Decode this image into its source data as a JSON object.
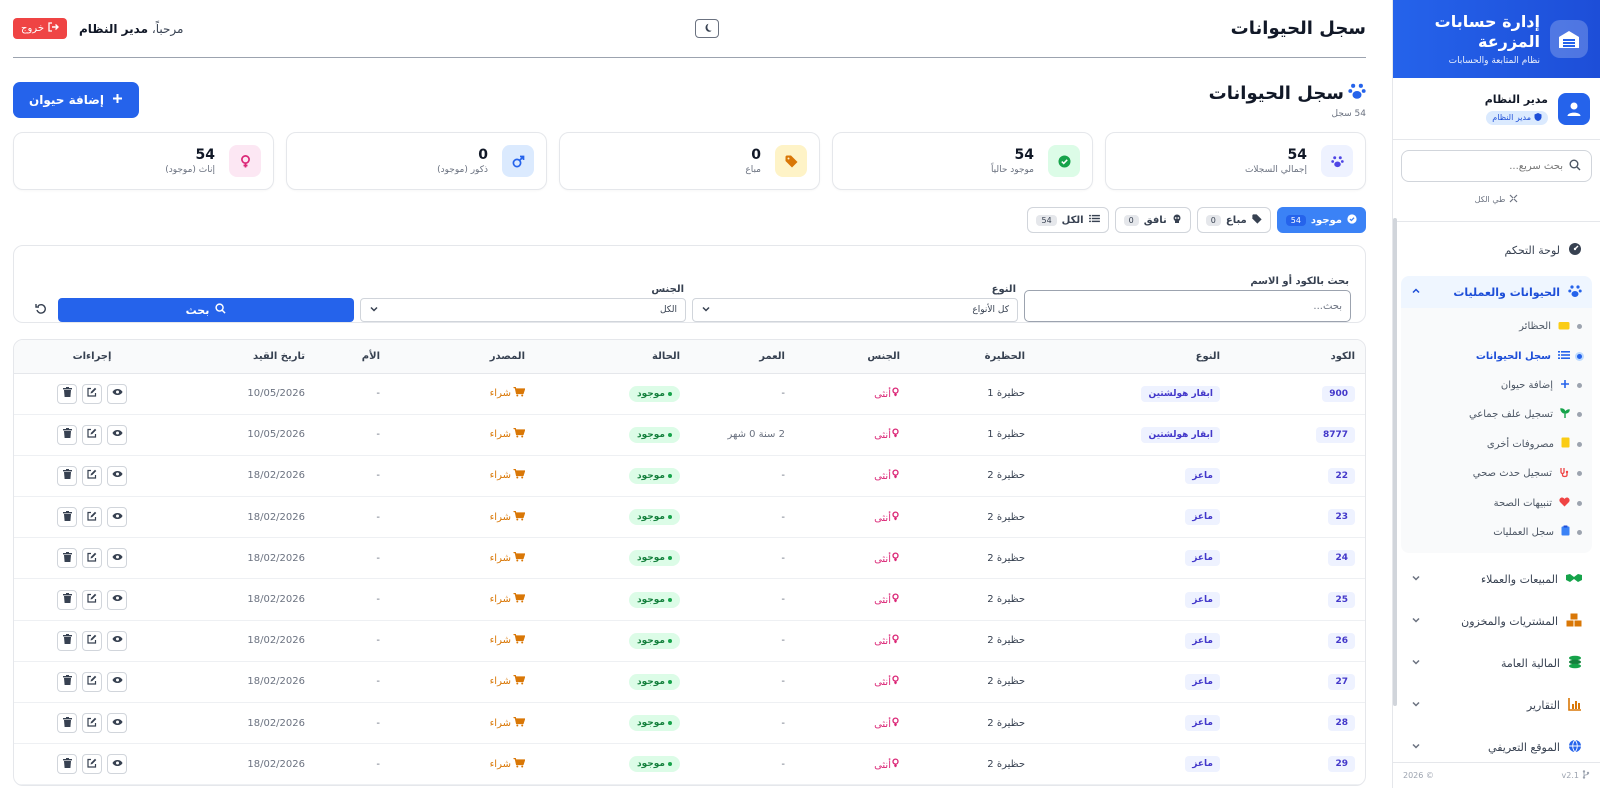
{
  "colors": {
    "primary": "#2563eb",
    "danger": "#ef4444",
    "success": "#16a34a",
    "warning": "#d97706",
    "pink": "#db2777"
  },
  "sidebar": {
    "title": "إدارة حسابات المزرعة",
    "subtitle": "نظام المتابعة والحسابات",
    "user_name": "مدير النظام",
    "user_role": "مدير النظام",
    "search_placeholder": "بحث سريع...",
    "collapse_label": "طي الكل",
    "nav": {
      "dashboard": "لوحة التحكم",
      "animals": "الحيوانات والعمليات",
      "sales": "المبيعات والعملاء",
      "purchases": "المشتريات والمخزون",
      "finance": "المالية العامة",
      "reports": "التقارير",
      "website": "الموقع التعريفي"
    },
    "subnav": {
      "pens": "الحظائر",
      "registry": "سجل الحيوانات",
      "add_animal": "إضافة حيوان",
      "group_feed": "تسجيل علف جماعي",
      "other_expenses": "مصروفات أخرى",
      "health_event": "تسجيل حدث صحي",
      "health_alerts": "تنبيهات الصحة",
      "operations_log": "سجل العمليات"
    },
    "version": "v2.1",
    "copyright": "© 2026"
  },
  "topbar": {
    "title": "سجل الحيوانات",
    "welcome": "مرحباً،",
    "user": "مدير النظام",
    "logout": "خروج"
  },
  "page": {
    "title": "سجل الحيوانات",
    "count": "54 سجل",
    "add_button": "إضافة حيوان"
  },
  "stats": {
    "total": {
      "value": "54",
      "label": "إجمالي السجلات"
    },
    "present": {
      "value": "54",
      "label": "موجود حالياً"
    },
    "sold": {
      "value": "0",
      "label": "مباع"
    },
    "males": {
      "value": "0",
      "label": "ذكور (موجود)"
    },
    "females": {
      "value": "54",
      "label": "إناث (موجود)"
    }
  },
  "filters": {
    "present": {
      "label": "موجود",
      "count": "54"
    },
    "sold": {
      "label": "مباع",
      "count": "0"
    },
    "dead": {
      "label": "نافق",
      "count": "0"
    },
    "all": {
      "label": "الكل",
      "count": "54"
    }
  },
  "search": {
    "text_label": "بحث بالكود أو الاسم",
    "text_placeholder": "بحث...",
    "type_label": "النوع",
    "type_value": "كل الأنواع",
    "gender_label": "الجنس",
    "gender_value": "الكل",
    "button": "بحث"
  },
  "table": {
    "headers": {
      "code": "الكود",
      "type": "النوع",
      "pen": "الحظيرة",
      "gender": "الجنس",
      "age": "العمر",
      "status": "الحالة",
      "source": "المصدر",
      "mother": "الأم",
      "date": "تاريخ القيد",
      "actions": "إجراءات"
    },
    "rows": [
      {
        "code": "900",
        "type": "ابقار هولشتين",
        "pen": "حظيرة 1",
        "gender": "أنثى",
        "age": "-",
        "status": "موجود",
        "source": "شراء",
        "mother": "-",
        "date": "10/05/2026"
      },
      {
        "code": "8777",
        "type": "ابقار هولشتين",
        "pen": "حظيرة 1",
        "gender": "أنثى",
        "age": "2 سنة 0 شهر",
        "status": "موجود",
        "source": "شراء",
        "mother": "-",
        "date": "10/05/2026"
      },
      {
        "code": "22",
        "type": "ماعز",
        "pen": "حظيرة 2",
        "gender": "أنثى",
        "age": "-",
        "status": "موجود",
        "source": "شراء",
        "mother": "-",
        "date": "18/02/2026"
      },
      {
        "code": "23",
        "type": "ماعز",
        "pen": "حظيرة 2",
        "gender": "أنثى",
        "age": "-",
        "status": "موجود",
        "source": "شراء",
        "mother": "-",
        "date": "18/02/2026"
      },
      {
        "code": "24",
        "type": "ماعز",
        "pen": "حظيرة 2",
        "gender": "أنثى",
        "age": "-",
        "status": "موجود",
        "source": "شراء",
        "mother": "-",
        "date": "18/02/2026"
      },
      {
        "code": "25",
        "type": "ماعز",
        "pen": "حظيرة 2",
        "gender": "أنثى",
        "age": "-",
        "status": "موجود",
        "source": "شراء",
        "mother": "-",
        "date": "18/02/2026"
      },
      {
        "code": "26",
        "type": "ماعز",
        "pen": "حظيرة 2",
        "gender": "أنثى",
        "age": "-",
        "status": "موجود",
        "source": "شراء",
        "mother": "-",
        "date": "18/02/2026"
      },
      {
        "code": "27",
        "type": "ماعز",
        "pen": "حظيرة 2",
        "gender": "أنثى",
        "age": "-",
        "status": "موجود",
        "source": "شراء",
        "mother": "-",
        "date": "18/02/2026"
      },
      {
        "code": "28",
        "type": "ماعز",
        "pen": "حظيرة 2",
        "gender": "أنثى",
        "age": "-",
        "status": "موجود",
        "source": "شراء",
        "mother": "-",
        "date": "18/02/2026"
      },
      {
        "code": "29",
        "type": "ماعز",
        "pen": "حظيرة 2",
        "gender": "أنثى",
        "age": "-",
        "status": "موجود",
        "source": "شراء",
        "mother": "-",
        "date": "18/02/2026"
      }
    ]
  }
}
